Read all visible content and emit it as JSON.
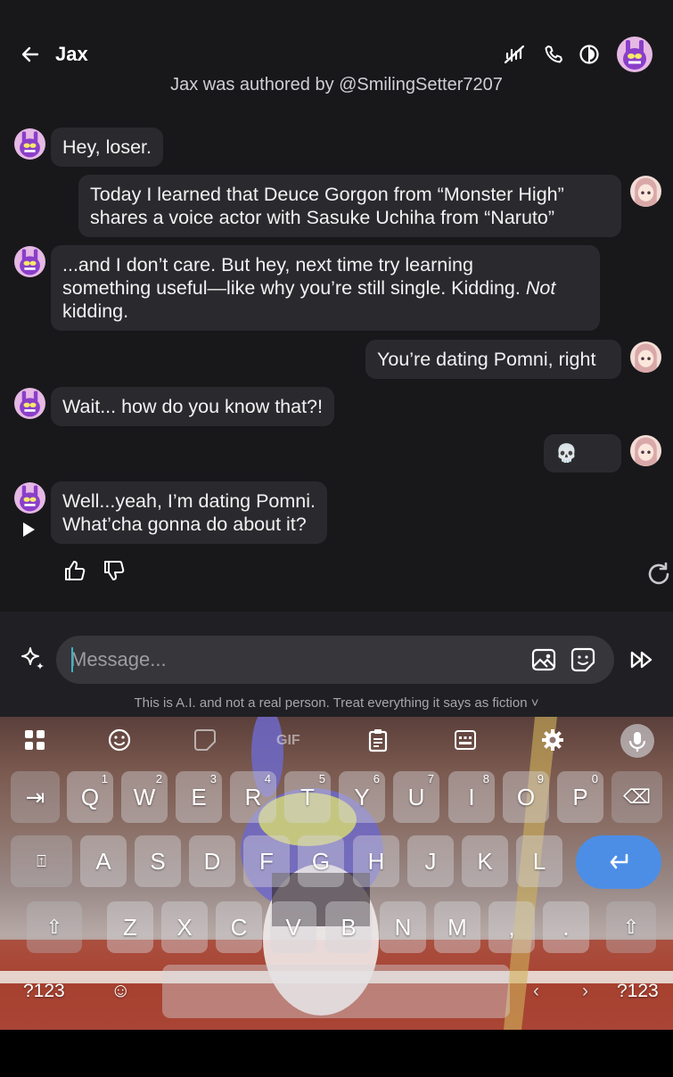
{
  "header": {
    "title": "Jax",
    "authored_by": "Jax was authored by @SmilingSetter7207"
  },
  "messages": [
    {
      "sender": "character",
      "text": "Hey, loser."
    },
    {
      "sender": "user",
      "line1": "Today I learned that Deuce Gorgon from “Monster High”",
      "line2": "shares a voice actor with Sasuke Uchiha from “Naruto”"
    },
    {
      "sender": "character",
      "line1": "...and I don’t care. But hey, next time try learning",
      "line2_a": "something useful—like why you’re still single. Kidding. ",
      "line2_em": "Not",
      "line3": "kidding."
    },
    {
      "sender": "user",
      "text": "You’re dating Pomni, right"
    },
    {
      "sender": "character",
      "text": "Wait... how do you know that?!"
    },
    {
      "sender": "user",
      "text": "💀"
    },
    {
      "sender": "character",
      "line1": "Well...yeah, I’m dating Pomni.",
      "line2": "What’cha gonna do about it?"
    }
  ],
  "composer": {
    "placeholder": "Message...",
    "disclaimer": "This is A.I. and not a real person. Treat everything it says as fiction ˅"
  },
  "keyboard": {
    "row1": [
      {
        "label": "Q",
        "hint": "1"
      },
      {
        "label": "W",
        "hint": "2"
      },
      {
        "label": "E",
        "hint": "3"
      },
      {
        "label": "R",
        "hint": "4"
      },
      {
        "label": "T",
        "hint": "5"
      },
      {
        "label": "Y",
        "hint": "6"
      },
      {
        "label": "U",
        "hint": "7"
      },
      {
        "label": "I",
        "hint": "8"
      },
      {
        "label": "O",
        "hint": "9"
      },
      {
        "label": "P",
        "hint": "0"
      }
    ],
    "row2": [
      "A",
      "S",
      "D",
      "F",
      "G",
      "H",
      "J",
      "K",
      "L"
    ],
    "row3": [
      "Z",
      "X",
      "C",
      "V",
      "B",
      "N",
      "M",
      ",",
      "."
    ],
    "symbols_left": "?123",
    "symbols_right": "?123",
    "emoji": "☺",
    "gif": "GIF",
    "tab": "⇥",
    "backspace": "⌫",
    "caps": "⍐",
    "shift": "⇧",
    "enter": "↵",
    "cursor_left": "‹",
    "cursor_right": "›"
  },
  "colors": {
    "background": "#18181b",
    "bubble": "#2a2a2e",
    "enter_key": "#4c8ee6",
    "caret": "#3fb0c8"
  }
}
